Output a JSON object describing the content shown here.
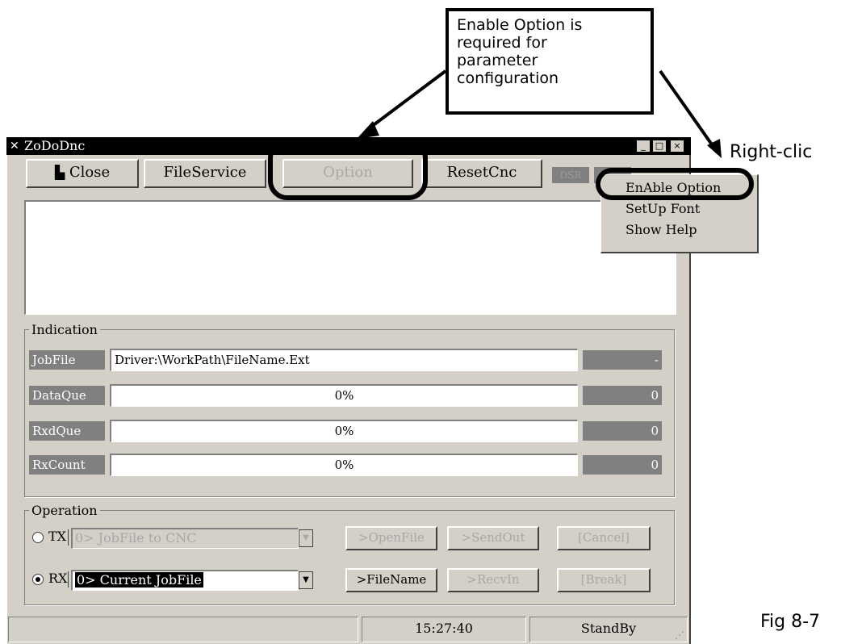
{
  "window": {
    "title": "ZoDoDnc",
    "title_icon": "app-icon",
    "controls": [
      "_",
      "□",
      "×"
    ]
  },
  "toolbar": {
    "close_label": "Close",
    "fileservice_label": "FileService",
    "option_label": "Option",
    "resetcnc_label": "ResetCnc",
    "dsr_label": "DSR"
  },
  "indication": {
    "title": "Indication",
    "rows": [
      {
        "label": "JobFile",
        "value": "Driver:\\WorkPath\\FileName.Ext",
        "count": "-"
      },
      {
        "label": "DataQue",
        "value": "0%",
        "count": "0"
      },
      {
        "label": "RxdQue",
        "value": "0%",
        "count": "0"
      },
      {
        "label": "RxCount",
        "value": "0%",
        "count": "0"
      }
    ]
  },
  "operation": {
    "title": "Operation",
    "tx": {
      "label": "TX",
      "combo": "0> JobFile to CNC",
      "buttons": [
        ">OpenFile",
        ">SendOut",
        "[Cancel]"
      ],
      "checked": false
    },
    "rx": {
      "label": "RX",
      "combo": "0> Current JobFile",
      "buttons": [
        ">FileName",
        ">RecvIn",
        "[Break]"
      ],
      "checked": true
    }
  },
  "statusbar": {
    "left": "",
    "time": "15:27:40",
    "status": "StandBy"
  },
  "context_menu": {
    "items": [
      "EnAble Option",
      "SetUp Font",
      "Show Help"
    ]
  },
  "annotations": {
    "callout_lines": [
      "Enable Option is",
      "required for",
      "parameter",
      "configuration"
    ],
    "right_click": "Right-clic",
    "figure": "Fig 8-7"
  },
  "colors": {
    "titlebar": "#000000",
    "face": "#d4d0c8",
    "indicator": "#808080"
  }
}
